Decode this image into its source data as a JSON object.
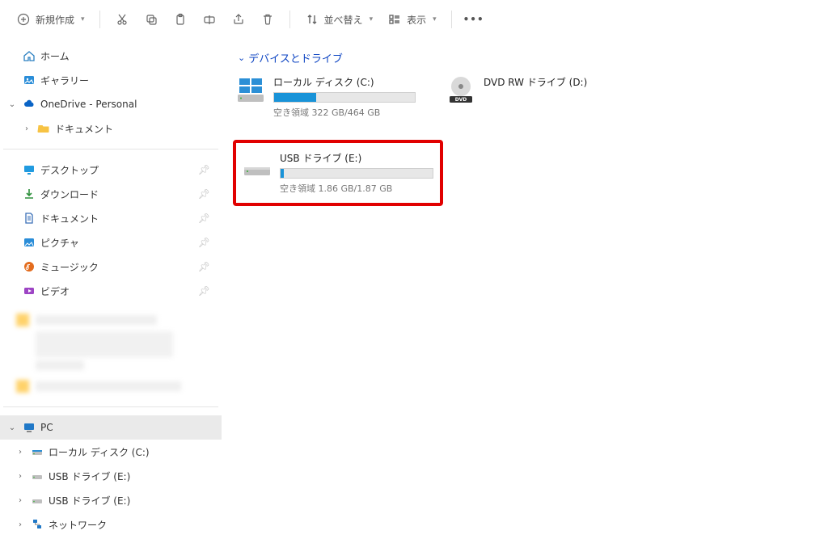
{
  "toolbar": {
    "new_label": "新規作成",
    "sort_label": "並べ替え",
    "view_label": "表示"
  },
  "sidebar": {
    "home": "ホーム",
    "gallery": "ギャラリー",
    "onedrive": "OneDrive - Personal",
    "documents": "ドキュメント",
    "desktop": "デスクトップ",
    "downloads": "ダウンロード",
    "documents2": "ドキュメント",
    "pictures": "ピクチャ",
    "music": "ミュージック",
    "videos": "ビデオ",
    "pc": "PC",
    "localdisk": "ローカル ディスク (C:)",
    "usbdrive": "USB ドライブ (E:)",
    "usbdrive2": "USB ドライブ (E:)",
    "network": "ネットワーク"
  },
  "main": {
    "group_title": "デバイスとドライブ",
    "drives": {
      "c": {
        "title": "ローカル ディスク (C:)",
        "sub": "空き領域 322 GB/464 GB",
        "pct": 30
      },
      "d": {
        "title": "DVD RW ドライブ (D:)"
      },
      "e": {
        "title": "USB ドライブ (E:)",
        "sub": "空き領域 1.86 GB/1.87 GB",
        "pct": 2
      }
    }
  }
}
